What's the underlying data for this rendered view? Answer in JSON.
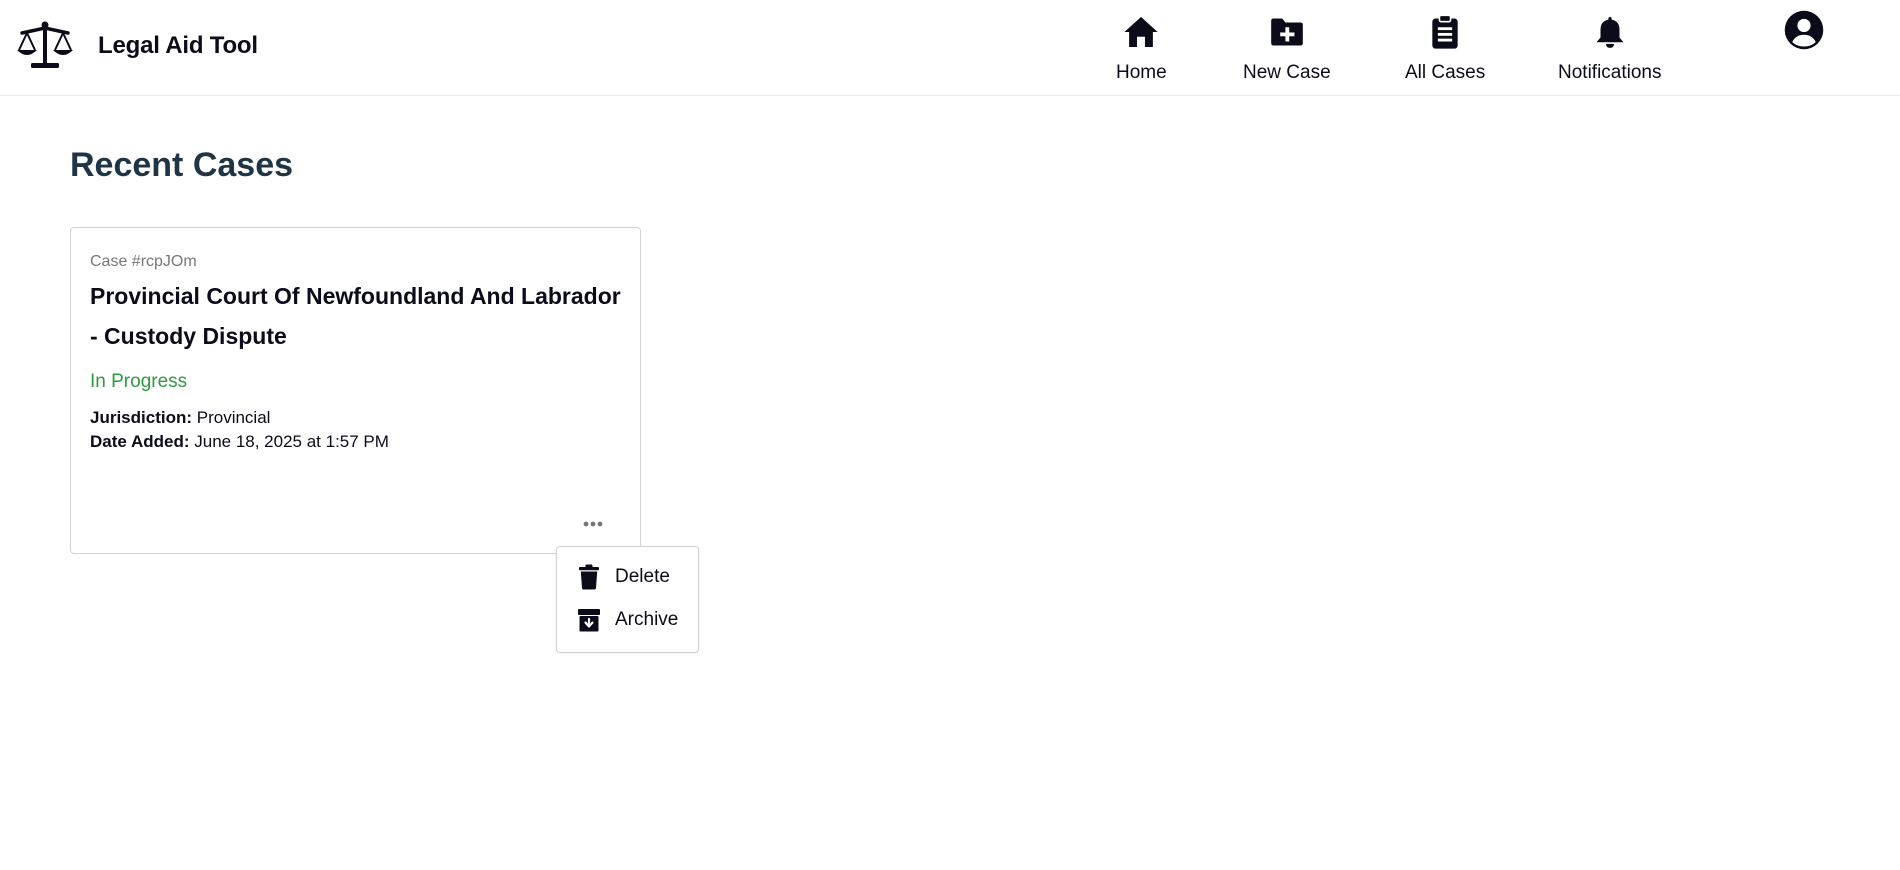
{
  "app": {
    "title": "Legal Aid Tool",
    "icon": "scales-of-justice-icon"
  },
  "nav": {
    "items": [
      {
        "label": "Home",
        "icon": "home-icon"
      },
      {
        "label": "New Case",
        "icon": "folder-plus-icon"
      },
      {
        "label": "All Cases",
        "icon": "clipboard-list-icon"
      },
      {
        "label": "Notifications",
        "icon": "bell-icon"
      }
    ],
    "profile_icon": "user-circle-icon"
  },
  "main": {
    "heading": "Recent Cases",
    "cases": [
      {
        "number": "Case #rcpJOm",
        "title": "Provincial Court Of Newfoundland And Labrador - Custody Dispute",
        "status": "In Progress",
        "jurisdiction_label": "Jurisdiction:",
        "jurisdiction": "Provincial",
        "date_label": "Date Added:",
        "date": "June 18, 2025 at 1:57 PM",
        "menu": {
          "items": [
            {
              "label": "Delete",
              "icon": "trash-icon"
            },
            {
              "label": "Archive",
              "icon": "archive-box-icon"
            }
          ]
        }
      }
    ]
  },
  "colors": {
    "text": "#0b0b1a",
    "heading": "#1f3545",
    "status_in_progress": "#2f9b3e",
    "muted": "#777777",
    "border": "#d2d2d2"
  }
}
